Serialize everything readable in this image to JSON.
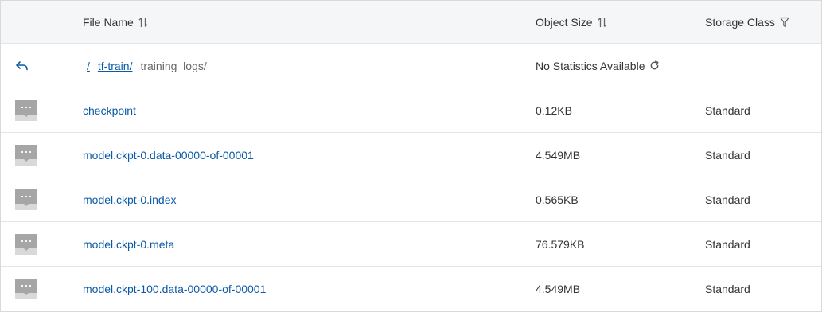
{
  "header": {
    "file_name": "File Name",
    "object_size": "Object Size",
    "storage_class": "Storage Class"
  },
  "breadcrumb": {
    "root": "/",
    "folder": "tf-train/",
    "current": "training_logs/",
    "stats_text": "No Statistics Available"
  },
  "icons": {
    "back": "back-arrow-icon",
    "file": "file-icon",
    "sort": "sort-icon",
    "filter": "filter-icon",
    "refresh": "refresh-icon"
  },
  "colors": {
    "link": "#0b5aa8",
    "header_bg": "#f5f6f8",
    "file_icon": "#a6a6a6"
  },
  "files": [
    {
      "name": "checkpoint",
      "size": "0.12KB",
      "storage_class": "Standard"
    },
    {
      "name": "model.ckpt-0.data-00000-of-00001",
      "size": "4.549MB",
      "storage_class": "Standard"
    },
    {
      "name": "model.ckpt-0.index",
      "size": "0.565KB",
      "storage_class": "Standard"
    },
    {
      "name": "model.ckpt-0.meta",
      "size": "76.579KB",
      "storage_class": "Standard"
    },
    {
      "name": "model.ckpt-100.data-00000-of-00001",
      "size": "4.549MB",
      "storage_class": "Standard"
    }
  ]
}
